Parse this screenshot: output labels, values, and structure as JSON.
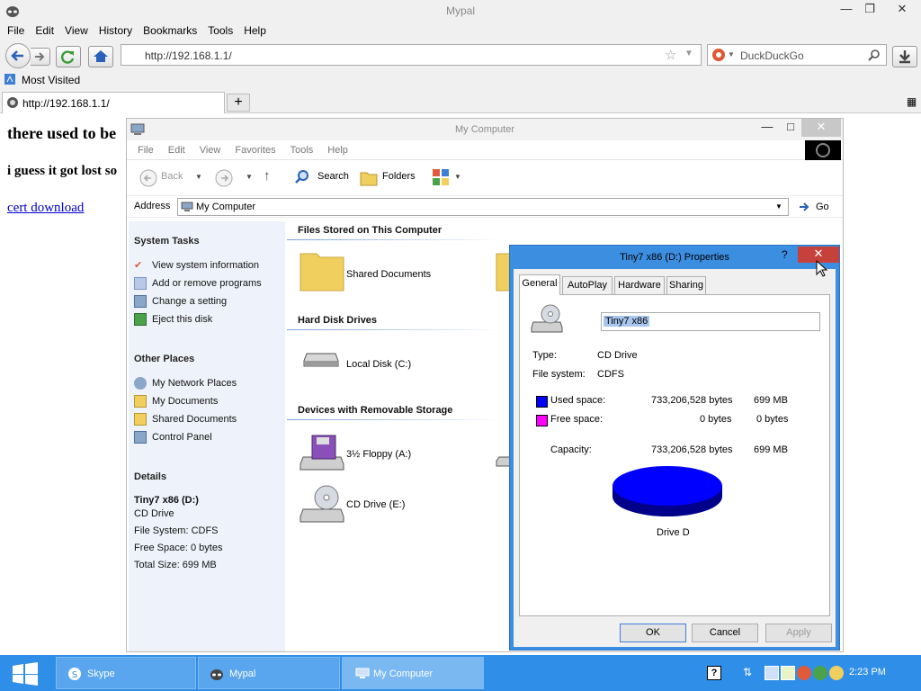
{
  "browser": {
    "title": "Mypal",
    "menu": [
      "File",
      "Edit",
      "View",
      "History",
      "Bookmarks",
      "Tools",
      "Help"
    ],
    "url": "http://192.168.1.1/",
    "search_placeholder": "DuckDuckGo",
    "bookmark": "Most Visited",
    "tab_title": "http://192.168.1.1/",
    "content": {
      "heading1": "there used to be",
      "heading2": "i guess it got lost so",
      "link": "cert download"
    }
  },
  "mycomputer": {
    "title": "My Computer",
    "menu": [
      "File",
      "Edit",
      "View",
      "Favorites",
      "Tools",
      "Help"
    ],
    "toolbar": {
      "back": "Back",
      "search": "Search",
      "folders": "Folders"
    },
    "address_label": "Address",
    "address_value": "My Computer",
    "go": "Go",
    "sidebar": {
      "system_tasks": {
        "heading": "System Tasks",
        "items": [
          "View system information",
          "Add or remove programs",
          "Change a setting",
          "Eject this disk"
        ]
      },
      "other_places": {
        "heading": "Other Places",
        "items": [
          "My Network Places",
          "My Documents",
          "Shared Documents",
          "Control Panel"
        ]
      },
      "details": {
        "heading": "Details",
        "name": "Tiny7 x86 (D:)",
        "lines": [
          "CD Drive",
          "File System: CDFS",
          "Free Space: 0 bytes",
          "Total Size: 699 MB"
        ]
      }
    },
    "groups": {
      "files": {
        "heading": "Files Stored on This Computer",
        "items": [
          "Shared Documents"
        ]
      },
      "hdd": {
        "heading": "Hard Disk Drives",
        "items": [
          "Local Disk (C:)"
        ]
      },
      "removable": {
        "heading": "Devices with Removable Storage",
        "items": [
          "3½ Floppy (A:)",
          "CD Drive (E:)"
        ]
      }
    }
  },
  "properties": {
    "title": "Tiny7 x86 (D:) Properties",
    "tabs": [
      "General",
      "AutoPlay",
      "Hardware",
      "Sharing"
    ],
    "volume_name": "Tiny7 x86",
    "type_label": "Type:",
    "type_value": "CD Drive",
    "fs_label": "File system:",
    "fs_value": "CDFS",
    "used_label": "Used space:",
    "used_bytes": "733,206,528 bytes",
    "used_size": "699 MB",
    "free_label": "Free space:",
    "free_bytes": "0 bytes",
    "free_size": "0 bytes",
    "capacity_label": "Capacity:",
    "capacity_bytes": "733,206,528 bytes",
    "capacity_size": "699 MB",
    "drive_label": "Drive D",
    "used_fraction": 1.0,
    "used_color": "#0000ff",
    "free_color": "#ff00ff",
    "buttons": {
      "ok": "OK",
      "cancel": "Cancel",
      "apply": "Apply"
    }
  },
  "taskbar": {
    "items": [
      "Skype",
      "Mypal",
      "My Computer"
    ],
    "clock": "2:23 PM",
    "color": "#2f8fe8"
  }
}
